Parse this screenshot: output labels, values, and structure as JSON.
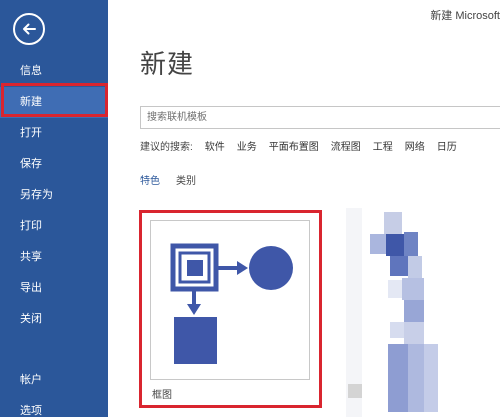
{
  "window": {
    "title": "新建 Microsoft"
  },
  "sidebar": {
    "back_icon": "back-arrow-icon",
    "items": [
      {
        "label": "信息"
      },
      {
        "label": "新建",
        "active": true
      },
      {
        "label": "打开"
      },
      {
        "label": "保存"
      },
      {
        "label": "另存为"
      },
      {
        "label": "打印"
      },
      {
        "label": "共享"
      },
      {
        "label": "导出"
      },
      {
        "label": "关闭"
      }
    ],
    "bottom_items": [
      {
        "label": "帐户"
      },
      {
        "label": "选项"
      }
    ]
  },
  "main": {
    "title": "新建",
    "search": {
      "placeholder": "搜索联机模板",
      "value": ""
    },
    "suggested": {
      "label": "建议的搜索:",
      "links": [
        "软件",
        "业务",
        "平面布置图",
        "流程图",
        "工程",
        "网络",
        "日历"
      ]
    },
    "filters": [
      {
        "label": "特色",
        "active": true
      },
      {
        "label": "类别",
        "active": false
      }
    ],
    "templates": [
      {
        "name": "框图",
        "icon": "block-diagram-icon"
      }
    ]
  },
  "colors": {
    "sidebar_bg": "#2b579a",
    "sidebar_active": "#3f6db4",
    "highlight": "#d9252f",
    "diagram_blue": "#3f57a8"
  }
}
